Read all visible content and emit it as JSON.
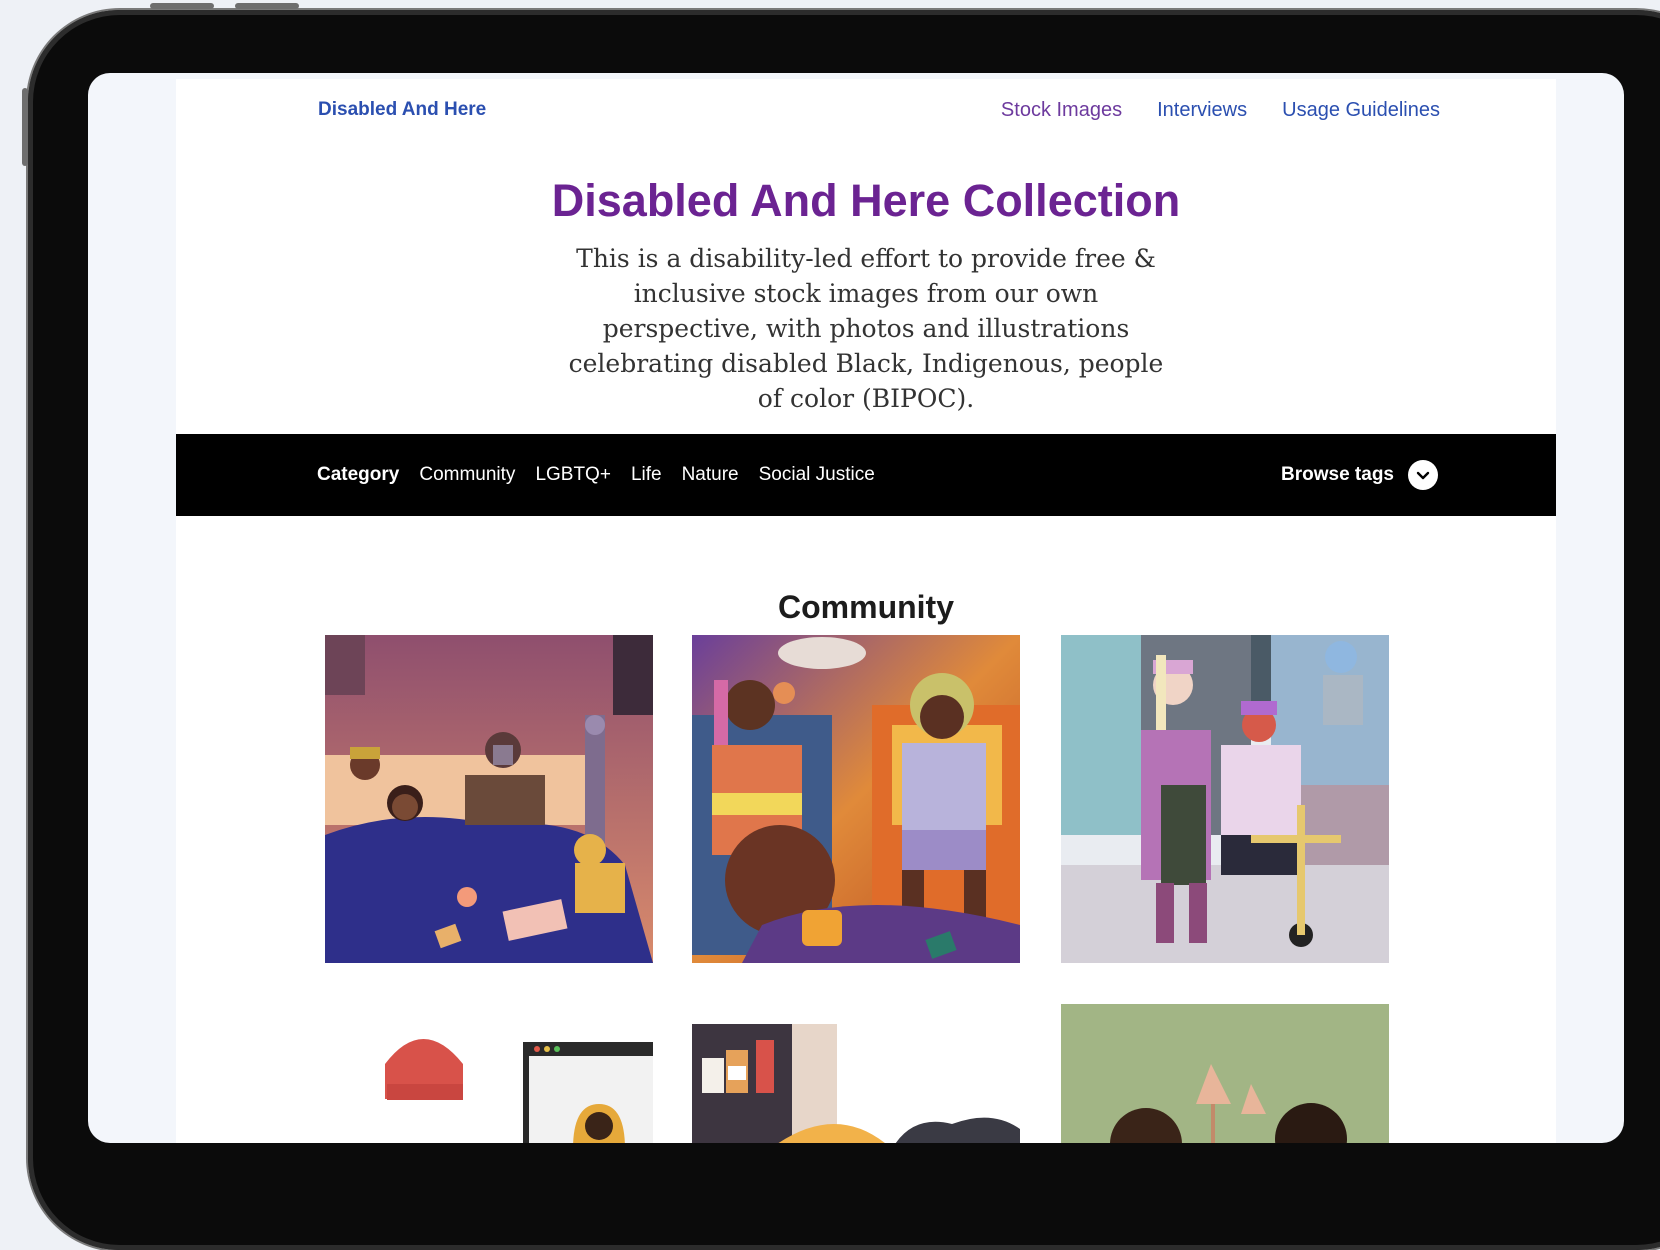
{
  "brand": {
    "name": "Disabled And Here"
  },
  "nav": {
    "links": [
      {
        "label": "Stock Images",
        "color": "#6d3a9e"
      },
      {
        "label": "Interviews",
        "color": "#2b4fb0"
      },
      {
        "label": "Usage Guidelines",
        "color": "#2b4fb0"
      }
    ]
  },
  "hero": {
    "title": "Disabled And Here Collection",
    "intro": "This is a disability-led effort to provide free & inclusive stock images from our own perspective, with photos and illustrations celebrating disabled Black, Indigenous, people of color (BIPOC)."
  },
  "categories": {
    "heading": "Category",
    "items": [
      "Community",
      "LGBTQ+",
      "Life",
      "Nature",
      "Social Justice"
    ],
    "browse_label": "Browse tags",
    "browse_icon": "chevron-down-icon"
  },
  "section": {
    "title": "Community"
  },
  "colors": {
    "accent": "#6b2392",
    "brand_link": "#2b4fb0",
    "category_bar": "#000000"
  }
}
